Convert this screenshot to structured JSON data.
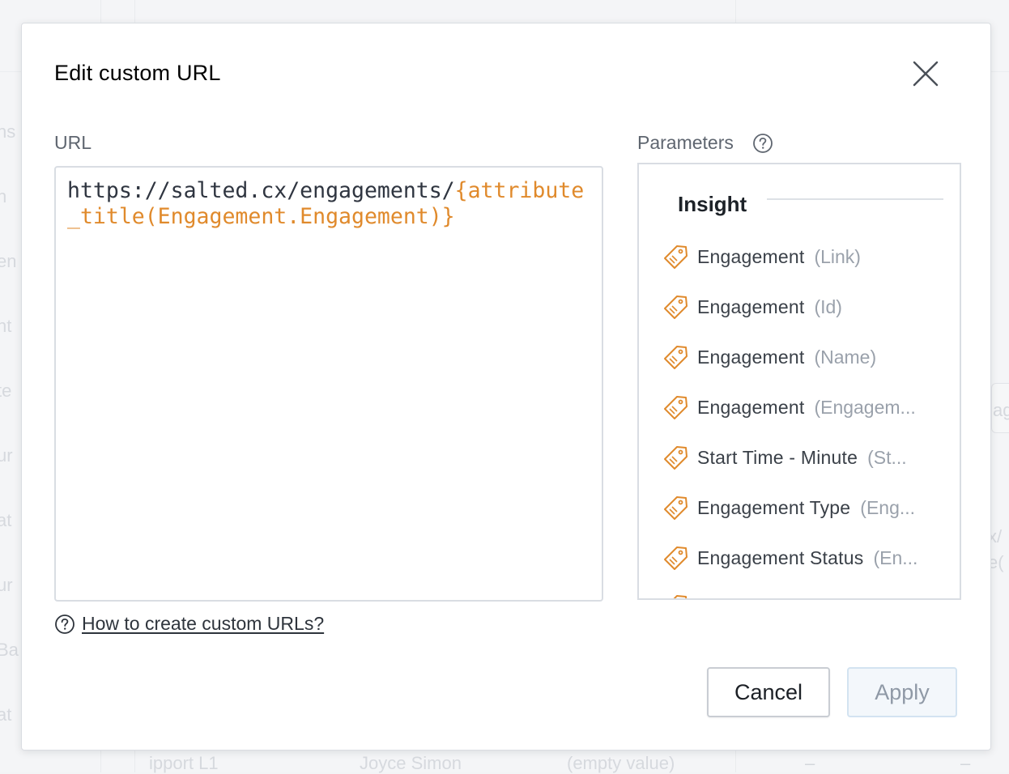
{
  "dialog": {
    "title": "Edit custom URL",
    "close_icon": "close-icon"
  },
  "url": {
    "label": "URL",
    "value_plain": "https://salted.cx/engagements/",
    "value_token": "{attribute_title(Engagement.Engagement)}"
  },
  "parameters": {
    "label": "Parameters",
    "help_icon": "question-circle-icon",
    "group_title": "Insight",
    "items": [
      {
        "name": "Engagement",
        "sub": "(Link)",
        "icon": "tag-icon"
      },
      {
        "name": "Engagement",
        "sub": "(Id)",
        "icon": "tag-icon"
      },
      {
        "name": "Engagement",
        "sub": "(Name)",
        "icon": "tag-icon"
      },
      {
        "name": "Engagement",
        "sub": "(Engagem...",
        "icon": "tag-icon"
      },
      {
        "name": "Start Time - Minute",
        "sub": "(St...",
        "icon": "tag-icon"
      },
      {
        "name": "Engagement Type",
        "sub": "(Eng...",
        "icon": "tag-icon"
      },
      {
        "name": "Engagement Status",
        "sub": "(En...",
        "icon": "tag-icon"
      }
    ]
  },
  "help": {
    "link_text": "How to create custom URLs?",
    "icon": "question-circle-icon"
  },
  "buttons": {
    "cancel": "Cancel",
    "apply": "Apply"
  },
  "background": {
    "fragments": [
      "ns",
      "h",
      "en",
      "nt",
      "te",
      "ur",
      "at",
      "ur",
      "Ba",
      "at",
      "ag",
      "x/",
      "e(",
      "ipport L1",
      "Joyce Simon",
      "(empty value)",
      "–",
      "–"
    ]
  },
  "colors": {
    "accent_orange": "#e08a2c",
    "text_primary": "#2f3540",
    "muted": "#9aa1ab"
  }
}
